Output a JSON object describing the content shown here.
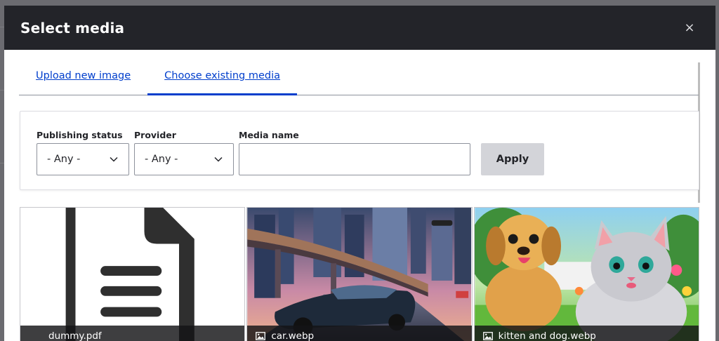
{
  "modal": {
    "title": "Select media",
    "close_label": "×"
  },
  "tabs": [
    {
      "label": "Upload new image",
      "active": false
    },
    {
      "label": "Choose existing media",
      "active": true
    }
  ],
  "filters": {
    "publishing_status": {
      "label": "Publishing status",
      "value": "- Any -"
    },
    "provider": {
      "label": "Provider",
      "value": "- Any -"
    },
    "media_name": {
      "label": "Media name",
      "value": "",
      "placeholder": ""
    },
    "apply_label": "Apply"
  },
  "media_items": [
    {
      "name": "dummy.pdf",
      "type": "document-icon"
    },
    {
      "name": "car.webp",
      "type": "image-icon"
    },
    {
      "name": "kitten and dog.webp",
      "type": "image-icon"
    }
  ],
  "colors": {
    "header_bg": "#232429",
    "link": "#003ecc",
    "apply_bg": "#d3d4d9"
  }
}
